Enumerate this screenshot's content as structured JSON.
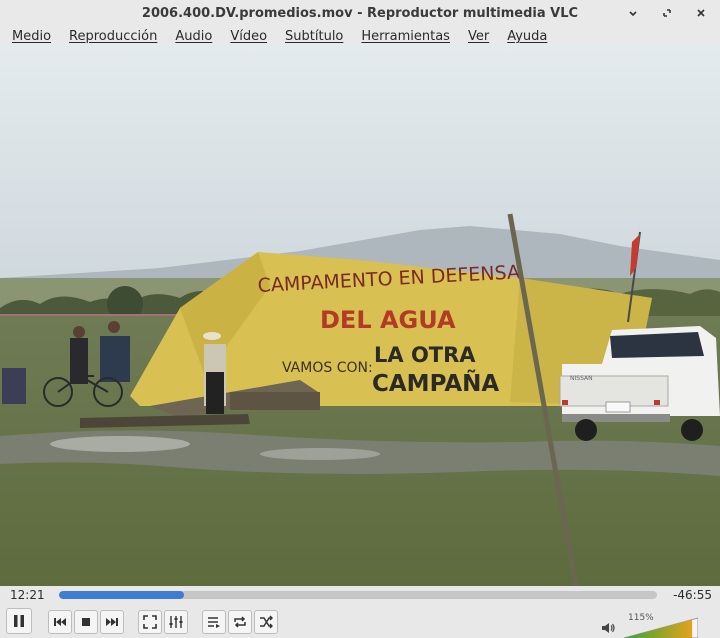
{
  "window": {
    "title": "2006.400.DV.promedios.mov - Reproductor multimedia VLC"
  },
  "menu": [
    "Medio",
    "Reproducción",
    "Audio",
    "Vídeo",
    "Subtítulo",
    "Herramientas",
    "Ver",
    "Ayuda"
  ],
  "video": {
    "banner_lines": [
      "CAMPAMENTO EN DEFENSA",
      "DEL AGUA",
      "VAMOS CON:",
      "LA OTRA",
      "CAMPAÑA"
    ],
    "truck_brand": "NISSAN",
    "icon": "video-frame"
  },
  "playback": {
    "current_time": "12:21",
    "remaining_time": "-46:55",
    "progress_fraction": 0.209
  },
  "controls": {
    "buttons": [
      "pause-icon",
      "previous-icon",
      "stop-icon",
      "next-icon",
      "fullscreen-icon",
      "extended-settings-icon",
      "playlist-icon",
      "loop-icon",
      "shuffle-icon"
    ]
  },
  "volume": {
    "level_label": "115%",
    "level_fraction": 1.15,
    "icon": "speaker-icon",
    "colors": {
      "low": "#37a43a",
      "high": "#f2a21a"
    }
  }
}
